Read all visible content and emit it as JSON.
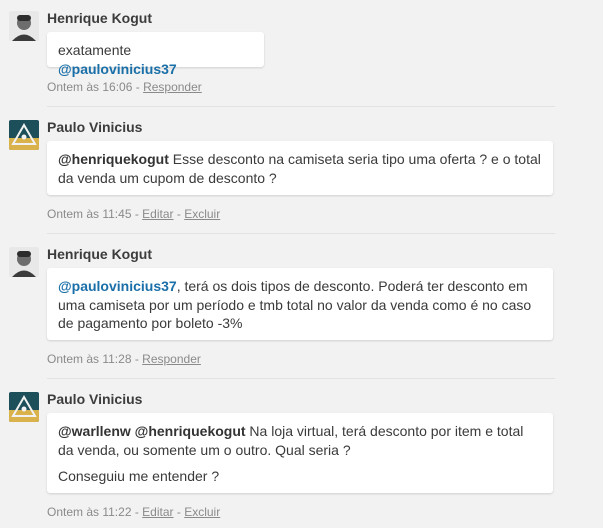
{
  "comments": [
    {
      "author": "Henrique Kogut",
      "avatar_icon": "person-avatar",
      "mention": "@paulovinicius37",
      "text_before": "exatamente ",
      "text_after": "",
      "time": "Ontem às 16:06",
      "actions": [
        "Responder"
      ]
    },
    {
      "author": "Paulo Vinicius",
      "avatar_icon": "triangle-logo-avatar",
      "mention": "@henriquekogut",
      "text_after": " Esse desconto na camiseta seria tipo uma oferta ? e o total da venda um cupom de desconto ?",
      "time": "Ontem às 11:45",
      "actions": [
        "Editar",
        "Excluir"
      ]
    },
    {
      "author": "Henrique Kogut",
      "avatar_icon": "person-avatar",
      "mention": "@paulovinicius37",
      "text_after": ", terá os dois tipos de desconto. Poderá ter desconto em uma camiseta por um período e tmb total no valor da venda como é no caso de pagamento por boleto -3%",
      "time": "Ontem às 11:28",
      "actions": [
        "Responder"
      ]
    },
    {
      "author": "Paulo Vinicius",
      "avatar_icon": "triangle-logo-avatar",
      "mention": "@warllenw @henriquekogut",
      "text_after": " Na loja virtual, terá desconto por item e total da venda, ou somente um o outro. Qual seria ?",
      "second_paragraph": "Conseguiu me entender ?",
      "time": "Ontem às 11:22",
      "actions": [
        "Editar",
        "Excluir"
      ]
    }
  ],
  "colors": {
    "background": "#f2f2f2",
    "mention": "#1a6fa8",
    "meta": "#8a8a8a"
  }
}
